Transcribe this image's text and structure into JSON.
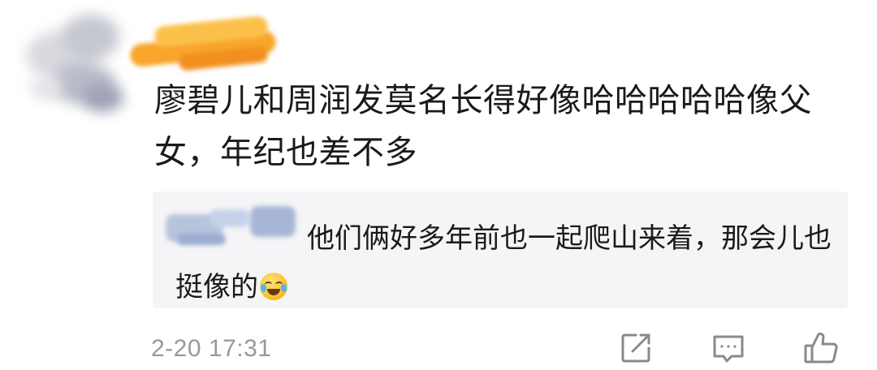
{
  "comment": {
    "text": "廖碧儿和周润发莫名长得好像哈哈哈哈哈像父女，年纪也差不多",
    "timestamp": "2-20 17:31"
  },
  "reply": {
    "text": "他们俩好多年前也一起爬山来着，那会儿也挺像的"
  },
  "icons": {
    "emoji": "laugh-cry-emoji-icon",
    "share": "share-edit-icon",
    "comment": "comment-bubble-icon",
    "like": "thumbs-up-icon"
  },
  "colors": {
    "text": "#1a1a1a",
    "muted": "#999999",
    "reply_bg": "#f5f5f7",
    "icon": "#8a8a8a"
  }
}
